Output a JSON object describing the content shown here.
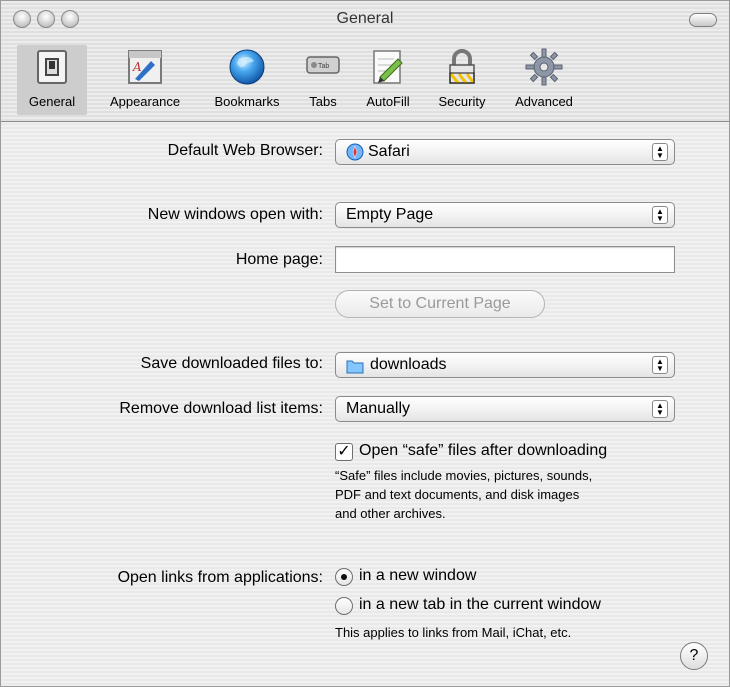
{
  "window": {
    "title": "General"
  },
  "toolbar": {
    "items": [
      {
        "label": "General",
        "icon": "switch-icon",
        "selected": true
      },
      {
        "label": "Appearance",
        "icon": "appearance-icon"
      },
      {
        "label": "Bookmarks",
        "icon": "globe-icon"
      },
      {
        "label": "Tabs",
        "icon": "tab-icon"
      },
      {
        "label": "AutoFill",
        "icon": "pencil-doc-icon"
      },
      {
        "label": "Security",
        "icon": "padlock-icon"
      },
      {
        "label": "Advanced",
        "icon": "gear-icon"
      }
    ],
    "tab_icon_text": "Tab"
  },
  "settings": {
    "default_browser": {
      "label": "Default Web Browser:",
      "value": "Safari"
    },
    "new_windows": {
      "label": "New windows open with:",
      "value": "Empty Page"
    },
    "home_page": {
      "label": "Home page:",
      "value": ""
    },
    "set_current_button": "Set to Current Page",
    "save_downloads": {
      "label": "Save downloaded files to:",
      "value": "downloads"
    },
    "remove_download": {
      "label": "Remove download list items:",
      "value": "Manually"
    },
    "open_safe": {
      "label": "Open “safe” files after downloading",
      "checked": true,
      "note_lines": [
        "“Safe” files include movies, pictures, sounds,",
        "PDF and text documents, and disk images",
        "and other archives."
      ]
    },
    "open_links": {
      "label": "Open links from applications:",
      "options": [
        "in a new window",
        "in a new tab in the current window"
      ],
      "selected_index": 0,
      "note": "This applies to links from Mail, iChat, etc."
    }
  },
  "help_glyph": "?"
}
